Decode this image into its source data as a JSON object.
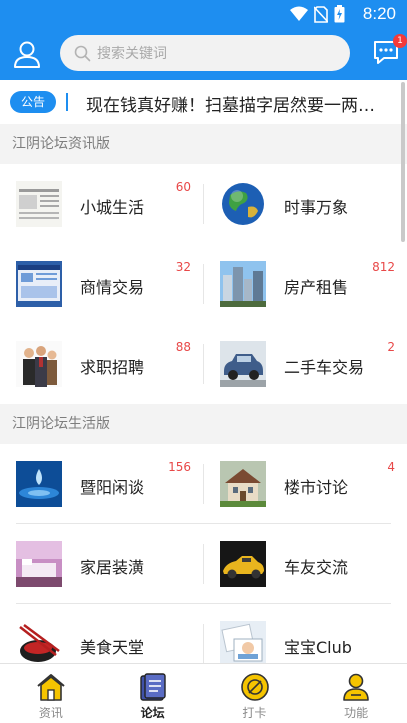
{
  "status_bar": {
    "time": "8:20"
  },
  "header": {
    "search_placeholder": "搜索关键词",
    "message_badge": "1"
  },
  "notice": {
    "tag": "公告",
    "text": "现在钱真好赚！扫墓描字居然要一两…"
  },
  "sections": [
    {
      "title": "江阴论坛资讯版",
      "items": [
        {
          "label": "小城生活",
          "count": "60",
          "icon": "newspaper-image"
        },
        {
          "label": "时事万象",
          "count": "",
          "icon": "globe-image"
        },
        {
          "label": "商情交易",
          "count": "32",
          "icon": "window-screen-image"
        },
        {
          "label": "房产租售",
          "count": "812",
          "icon": "buildings-image"
        },
        {
          "label": "求职招聘",
          "count": "88",
          "icon": "business-people-image"
        },
        {
          "label": "二手车交易",
          "count": "2",
          "icon": "mini-car-image"
        }
      ]
    },
    {
      "title": "江阴论坛生活版",
      "items": [
        {
          "label": "暨阳闲谈",
          "count": "156",
          "icon": "water-drop-image"
        },
        {
          "label": "楼市讨论",
          "count": "4",
          "icon": "villa-image"
        },
        {
          "label": "家居装潢",
          "count": "",
          "icon": "bedroom-image"
        },
        {
          "label": "车友交流",
          "count": "",
          "icon": "sports-car-image"
        },
        {
          "label": "美食天堂",
          "count": "",
          "icon": "chopsticks-bowl-image"
        },
        {
          "label": "宝宝Club",
          "count": "",
          "icon": "baby-photo-image"
        }
      ]
    }
  ],
  "tabs": [
    {
      "label": "资讯",
      "icon": "home-icon",
      "active": false
    },
    {
      "label": "论坛",
      "icon": "book-icon",
      "active": true
    },
    {
      "label": "打卡",
      "icon": "clock-in-icon",
      "active": false
    },
    {
      "label": "功能",
      "icon": "person-icon",
      "active": false
    }
  ],
  "colors": {
    "primary": "#1e8ef0",
    "count_red": "#e84848",
    "tab_yellow": "#f5c400"
  }
}
